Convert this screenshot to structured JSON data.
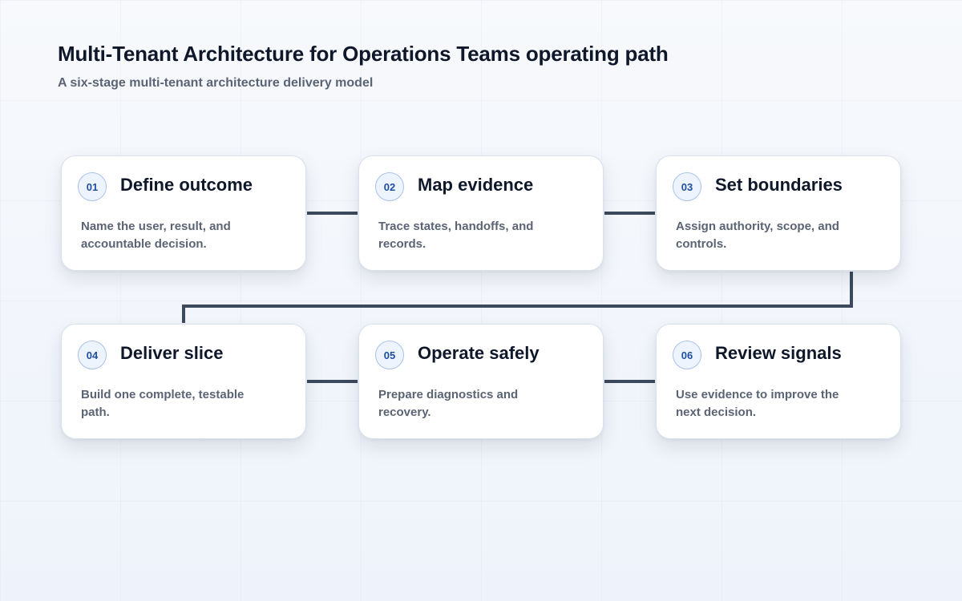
{
  "header": {
    "title": "Multi-Tenant Architecture for Operations Teams operating path",
    "subtitle": "A six-stage multi-tenant architecture delivery model"
  },
  "stages": [
    {
      "number": "01",
      "title": "Define outcome",
      "description": "Name the user, result, and accountable decision."
    },
    {
      "number": "02",
      "title": "Map evidence",
      "description": "Trace states, handoffs, and records."
    },
    {
      "number": "03",
      "title": "Set boundaries",
      "description": "Assign authority, scope, and controls."
    },
    {
      "number": "04",
      "title": "Deliver slice",
      "description": "Build one complete, testable path."
    },
    {
      "number": "05",
      "title": "Operate safely",
      "description": "Prepare diagnostics and recovery."
    },
    {
      "number": "06",
      "title": "Review signals",
      "description": "Use evidence to improve the next decision."
    }
  ],
  "colors": {
    "connector": "#3c4a5c",
    "badge_text": "#1e4fa3",
    "badge_border": "#a9c1ea",
    "title_text": "#0f172a",
    "body_text": "#5b6474"
  }
}
